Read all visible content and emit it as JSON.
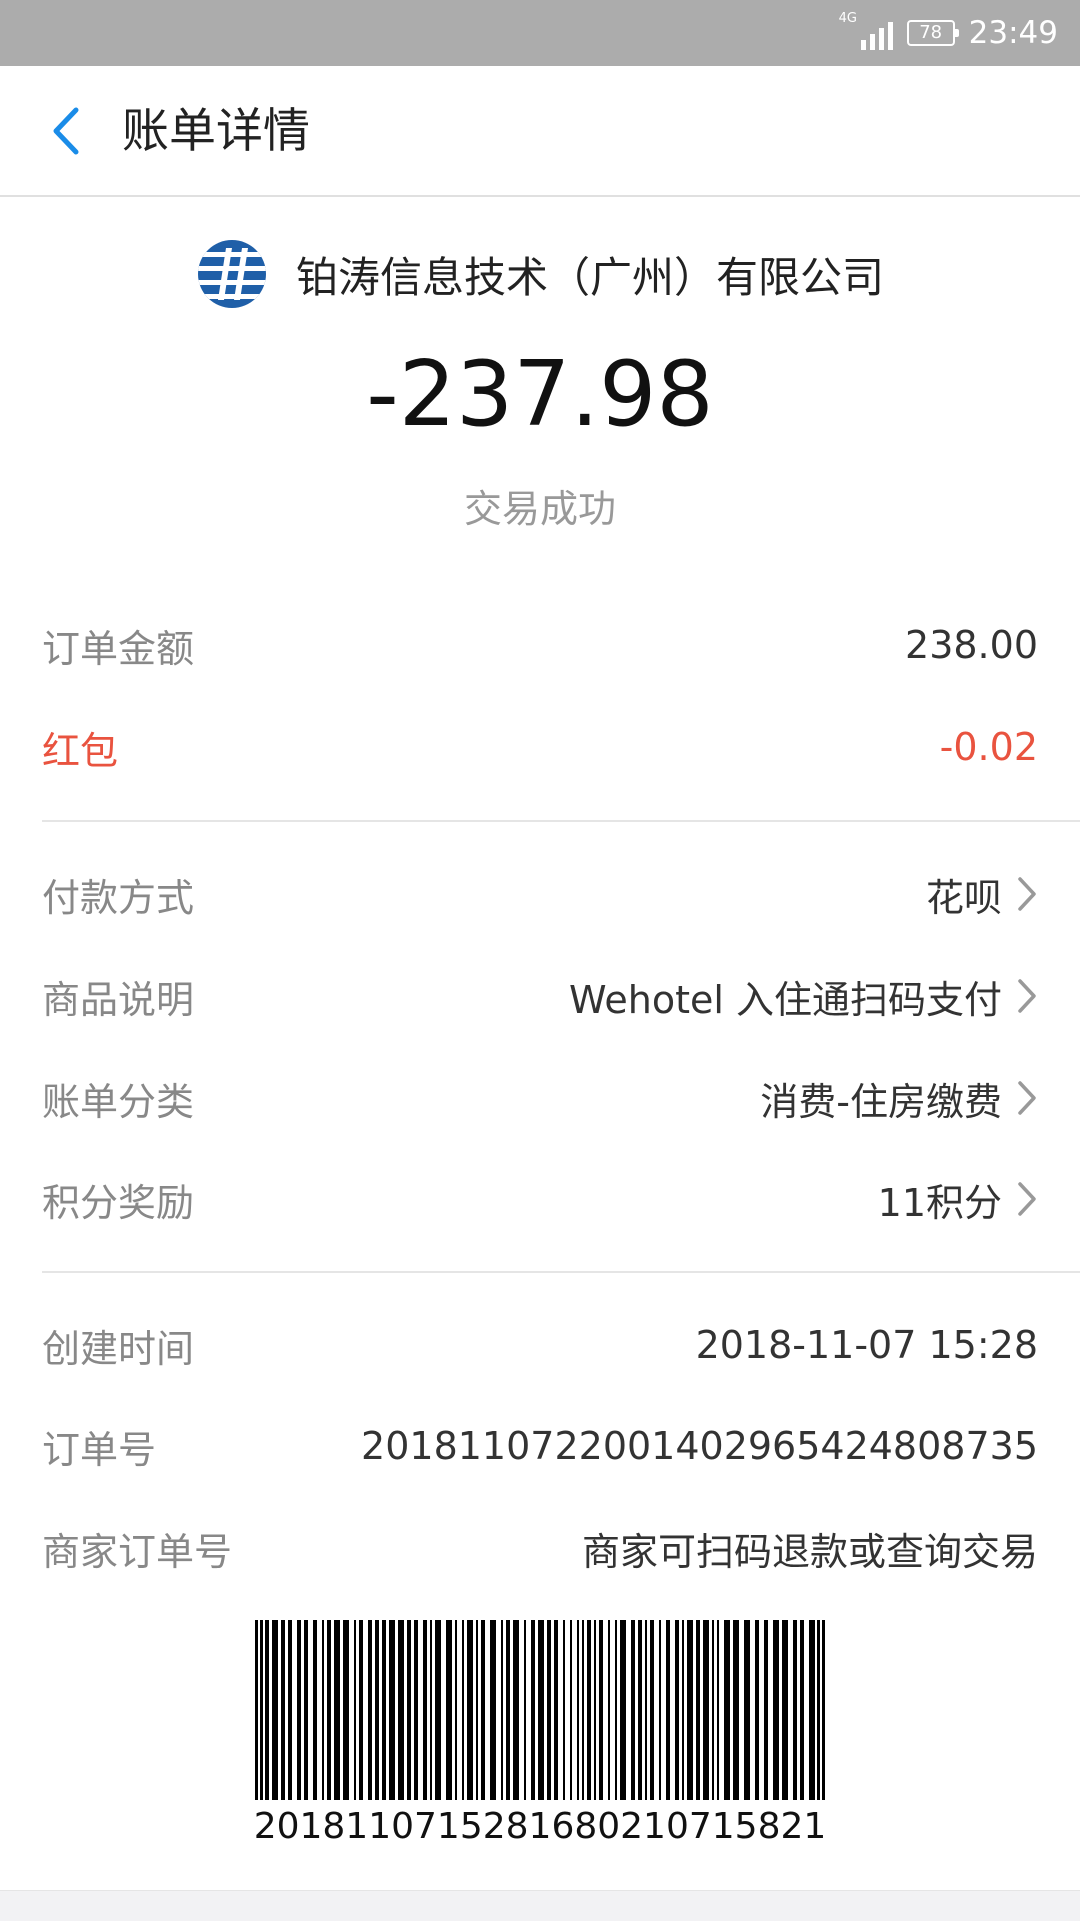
{
  "status_bar": {
    "network": "4G",
    "battery": "78",
    "time": "23:49"
  },
  "nav": {
    "title": "账单详情",
    "back_icon": "chevron-left-icon"
  },
  "merchant": {
    "name": "铂涛信息技术（广州）有限公司",
    "logo_icon": "merchant-logo-icon"
  },
  "amount": "-237.98",
  "status": "交易成功",
  "amounts": [
    {
      "label": "订单金额",
      "value": "238.00"
    },
    {
      "label": "红包",
      "value": "-0.02"
    }
  ],
  "info": [
    {
      "label": "付款方式",
      "value": "花呗"
    },
    {
      "label": "商品说明",
      "value": "Wehotel 入住通扫码支付"
    },
    {
      "label": "账单分类",
      "value": "消费-住房缴费"
    },
    {
      "label": "积分奖励",
      "value": "11积分"
    }
  ],
  "details": [
    {
      "label": "创建时间",
      "value": "2018-11-07 15:28"
    },
    {
      "label": "订单号",
      "value": "20181107220014029654248087​35"
    },
    {
      "label": "商家订单号",
      "value": "商家可扫码退款或查询交易"
    }
  ],
  "barcode_number": "2018110715281680210715821",
  "colors": {
    "accent": "#1a8ce8",
    "red": "#e9533f",
    "status_bar": "#acacac"
  }
}
